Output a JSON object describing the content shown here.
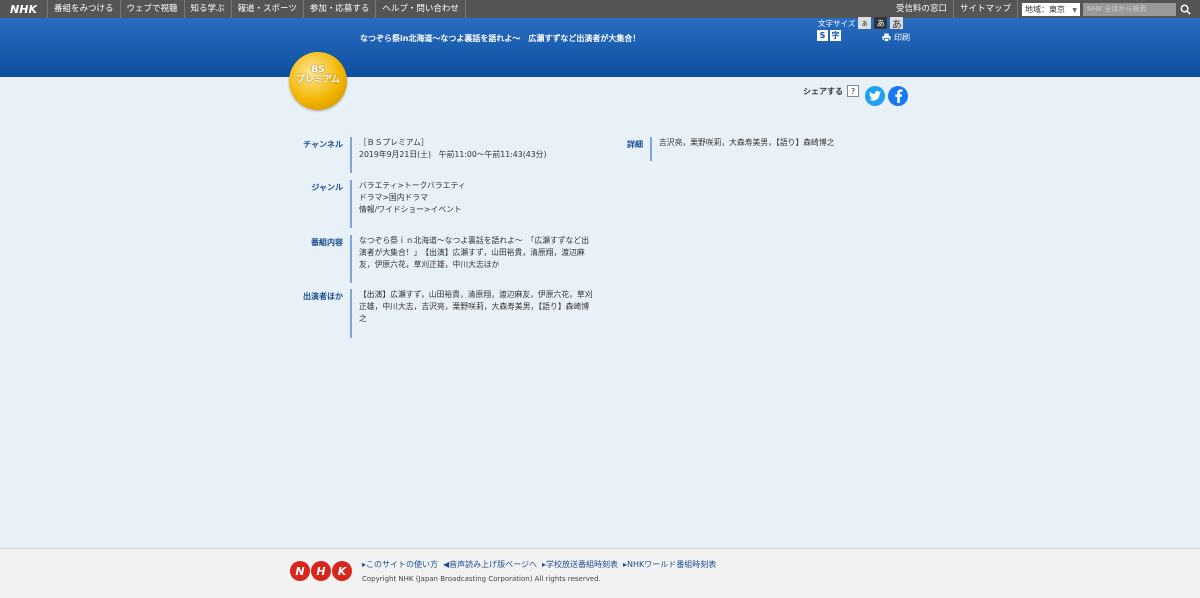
{
  "topnav": {
    "logo": "NHK",
    "items": [
      "番組をみつける",
      "ウェブで視聴",
      "知る学ぶ",
      "報道・スポーツ",
      "参加・応募する",
      "ヘルプ・問い合わせ"
    ],
    "right_items": [
      "受信料の窓口",
      "サイトマップ"
    ],
    "region": "地域：東京",
    "search_placeholder": "NHK 全体から検索"
  },
  "header": {
    "program_title": "なつぞら祭in北海道〜なつよ裏話を語れよ〜　広瀬すずなど出演者が大集合！",
    "font_size_label": "文字サイズ",
    "font_size_options": [
      "あ",
      "あ",
      "あ"
    ],
    "badges": [
      "S",
      "字"
    ],
    "print_label": "印刷"
  },
  "channel_logo": {
    "line1": "BS",
    "line2": "プレミアム"
  },
  "share": {
    "label": "シェアする",
    "help": "?"
  },
  "details": {
    "channel": {
      "label": "チャンネル",
      "lines": [
        "［ＢＳプレミアム］",
        "2019年9月21日(土)　午前11:00〜午前11:43(43分)"
      ]
    },
    "genre": {
      "label": "ジャンル",
      "lines": [
        "バラエティ>トークバラエティ",
        "ドラマ>国内ドラマ",
        "情報/ワイドショー>イベント"
      ]
    },
    "content": {
      "label": "番組内容",
      "lines": [
        "なつぞら祭ｉｎ北海道〜なつよ裏話を語れよ〜　「広瀬すずなど出",
        "演者が大集合！」　【出演】広瀬すず，山田裕貴，清原翔，渡辺麻",
        "友，伊原六花，草刈正雄，中川大志ほか"
      ]
    },
    "cast": {
      "label": "出演者ほか",
      "lines": [
        "【出演】広瀬すず，山田裕貴，清原翔，渡辺麻友，伊原六花，草刈",
        "正雄，中川大志，吉沢亮，栗野咲莉，大森寿美男，【語り】森崎博",
        "之"
      ]
    },
    "detail": {
      "label": "詳細",
      "lines": [
        "吉沢亮，栗野咲莉，大森寿美男，【語り】森崎博之"
      ]
    }
  },
  "footer": {
    "logo_letters": [
      "N",
      "H",
      "K"
    ],
    "links": [
      "▸このサイトの使い方",
      "◀音声読み上げ版ページへ",
      "▸学校放送番組時刻表",
      "▸NHKワールド番組時刻表"
    ],
    "copyright": "Copyright NHK (Japan Broadcasting Corporation) All rights reserved."
  }
}
